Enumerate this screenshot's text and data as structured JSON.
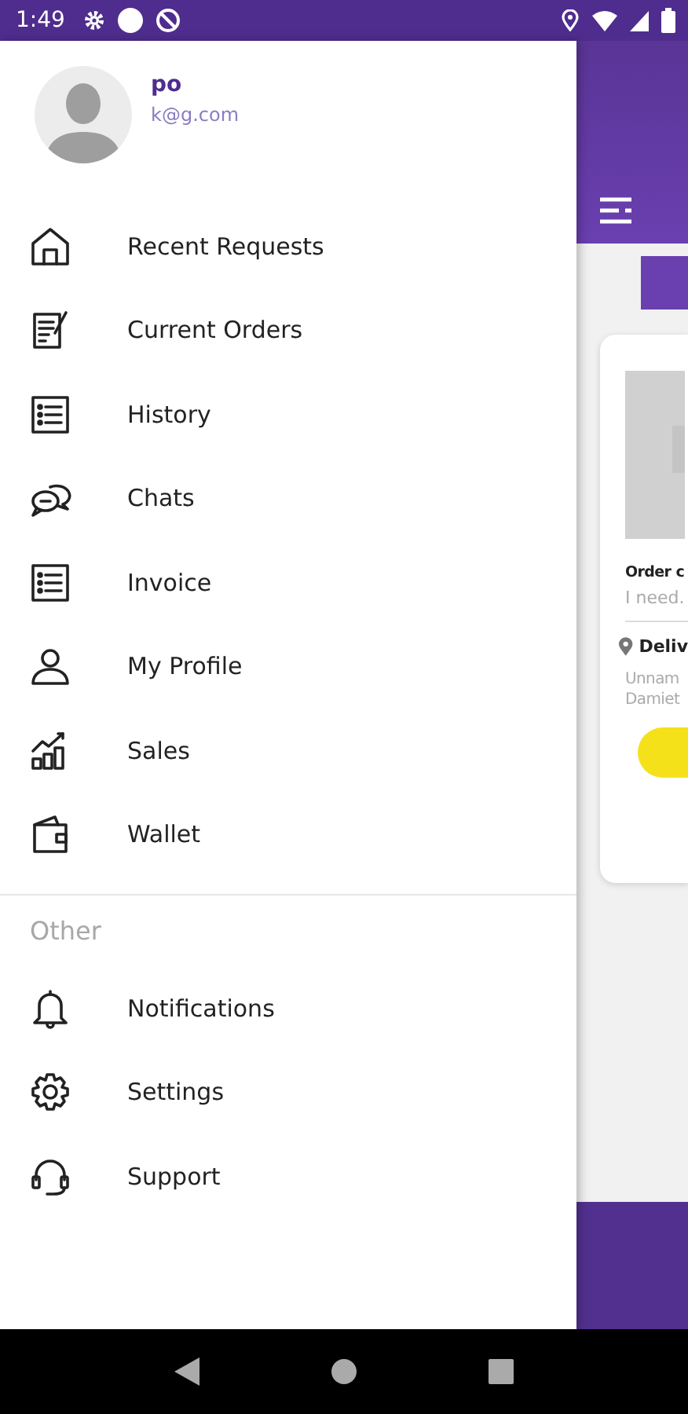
{
  "status_bar": {
    "time": "1:49"
  },
  "drawer": {
    "user": {
      "name": "po",
      "email": "k@g.com"
    },
    "items": [
      {
        "label": "Recent Requests"
      },
      {
        "label": "Current Orders"
      },
      {
        "label": "History"
      },
      {
        "label": "Chats"
      },
      {
        "label": "Invoice"
      },
      {
        "label": "My Profile"
      },
      {
        "label": "Sales"
      },
      {
        "label": "Wallet"
      }
    ],
    "other_section": {
      "title": "Other",
      "items": [
        {
          "label": "Notifications"
        },
        {
          "label": "Settings"
        },
        {
          "label": "Support"
        }
      ]
    }
  },
  "background_card": {
    "title": "Order c",
    "description": "I need.",
    "location_label": "Deliv",
    "address_lines": [
      "Unnam",
      "Damiet"
    ]
  }
}
